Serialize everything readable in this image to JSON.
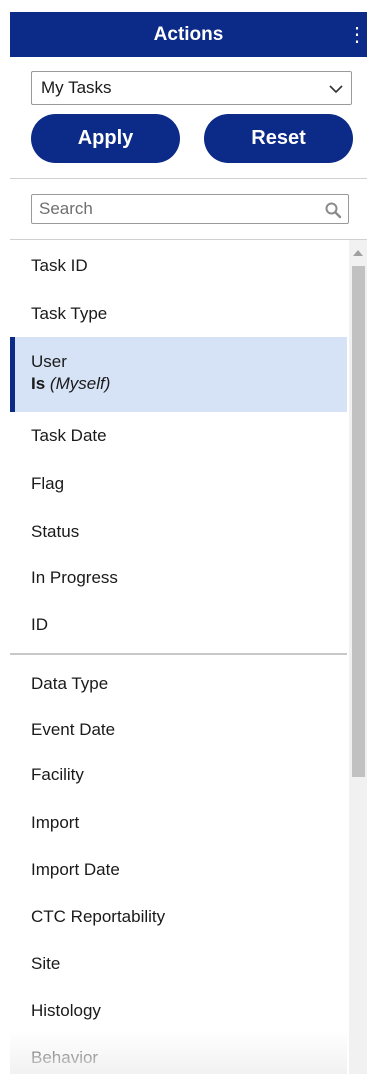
{
  "header": {
    "title": "Actions",
    "menu_icon": "kebab-menu-icon"
  },
  "filter_select": {
    "value": "My Tasks",
    "icon": "chevron-down-icon"
  },
  "buttons": {
    "apply": "Apply",
    "reset": "Reset"
  },
  "search": {
    "placeholder": "Search",
    "value": "",
    "icon": "search-icon"
  },
  "colors": {
    "brand": "#0c2a87",
    "selected_bg": "#d6e3f7",
    "divider": "#c8c8c8"
  },
  "list": {
    "selected_index": 2,
    "group1": [
      {
        "label": "Task ID"
      },
      {
        "label": "Task Type"
      },
      {
        "label": "User",
        "condition_op": "Is",
        "condition_value": "(Myself)"
      },
      {
        "label": "Task Date"
      },
      {
        "label": "Flag"
      },
      {
        "label": "Status"
      },
      {
        "label": "In Progress"
      },
      {
        "label": "ID"
      }
    ],
    "group2": [
      {
        "label": "Data Type"
      },
      {
        "label": "Event Date"
      },
      {
        "label": "Facility"
      },
      {
        "label": "Import"
      },
      {
        "label": "Import Date"
      },
      {
        "label": "CTC Reportability"
      },
      {
        "label": "Site"
      },
      {
        "label": "Histology"
      },
      {
        "label": "Behavior"
      }
    ]
  }
}
